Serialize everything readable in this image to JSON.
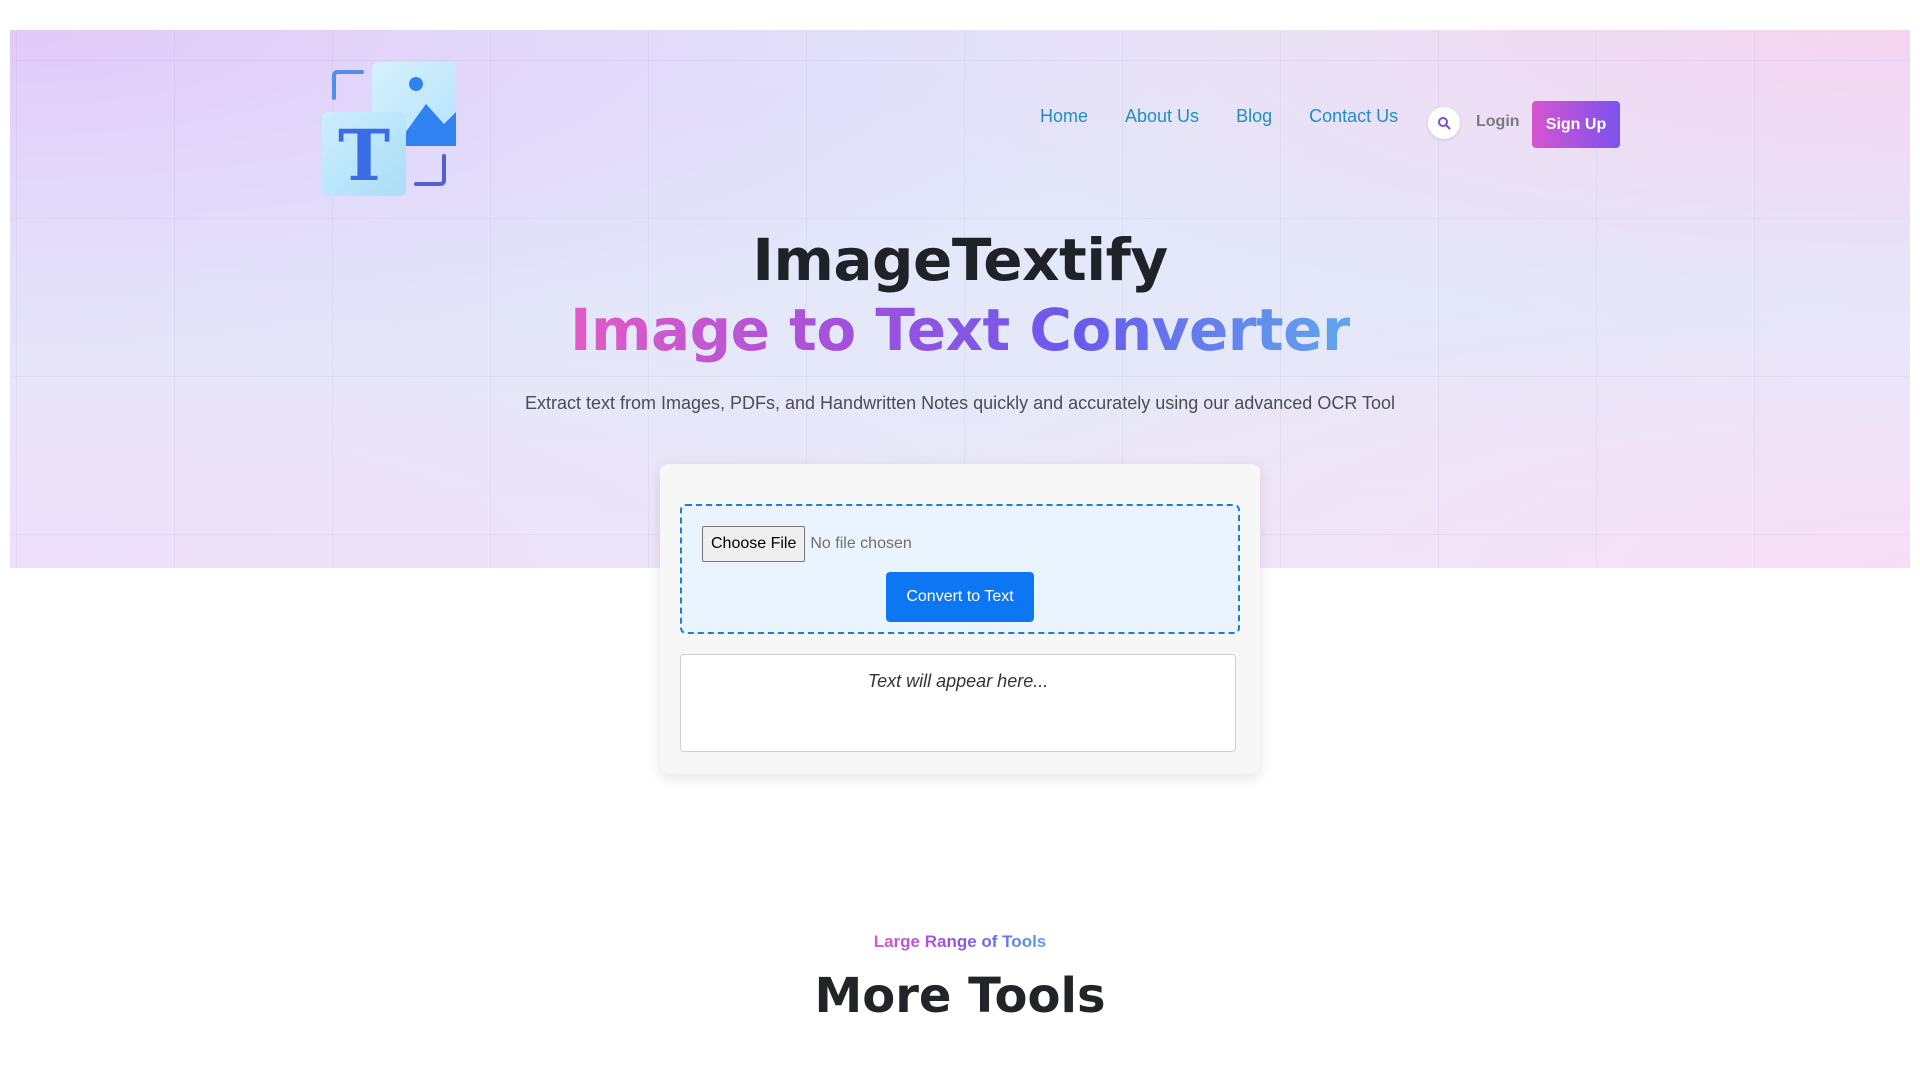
{
  "brand": {
    "logo_letter": "T"
  },
  "nav": {
    "links": [
      "Home",
      "About Us",
      "Blog",
      "Contact Us"
    ],
    "search_icon": "search-icon",
    "login_label": "Login",
    "signup_label": "Sign Up"
  },
  "hero": {
    "title": "ImageTextify",
    "subtitle": "Image to Text Converter",
    "tagline": "Extract text from Images, PDFs, and Handwritten Notes quickly and accurately using our advanced OCR Tool"
  },
  "converter": {
    "choose_file_label": "Choose File",
    "file_status": "No file chosen",
    "convert_label": "Convert to Text",
    "output_placeholder": "Text will appear here..."
  },
  "more_tools": {
    "eyebrow": "Large Range of Tools",
    "title": "More Tools"
  },
  "colors": {
    "nav_link": "#1d8fc4",
    "convert_button": "#0d77f3",
    "signup_gradient_start": "#d655d0",
    "signup_gradient_end": "#7b52ee",
    "dropzone_border": "#1a7fd6"
  }
}
